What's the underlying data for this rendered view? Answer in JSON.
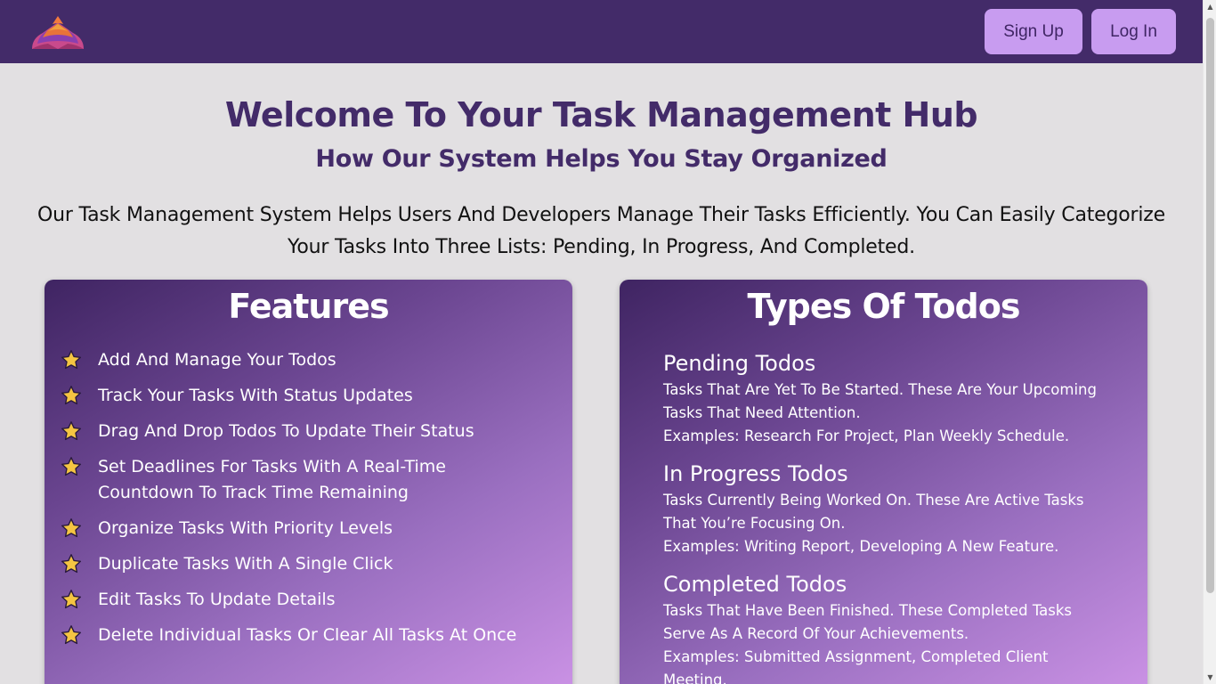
{
  "header": {
    "logo_icon": "layered-pyramid-logo-icon",
    "signup_label": "Sign Up",
    "login_label": "Log In"
  },
  "hero": {
    "title": "Welcome To Your Task Management Hub",
    "subtitle": "How Our System Helps You Stay Organized",
    "description": "Our Task Management System Helps Users And Developers Manage Their Tasks Efficiently. You Can Easily Categorize Your Tasks Into Three Lists: Pending, In Progress, And Completed."
  },
  "features": {
    "title": "Features",
    "icon": "star-icon",
    "items": [
      "Add And Manage Your Todos",
      "Track Your Tasks With Status Updates",
      "Drag And Drop Todos To Update Their Status",
      "Set Deadlines For Tasks With A Real-Time Countdown To Track Time Remaining",
      "Organize Tasks With Priority Levels",
      "Duplicate Tasks With A Single Click",
      "Edit Tasks To Update Details",
      "Delete Individual Tasks Or Clear All Tasks At Once"
    ]
  },
  "types": {
    "title": "Types Of Todos",
    "items": [
      {
        "title": "Pending Todos",
        "description": "Tasks That Are Yet To Be Started. These Are Your Upcoming Tasks That Need Attention.",
        "examples": "Examples: Research For Project, Plan Weekly Schedule."
      },
      {
        "title": "In Progress Todos",
        "description": "Tasks Currently Being Worked On. These Are Active Tasks That You’re Focusing On.",
        "examples": "Examples: Writing Report, Developing A New Feature."
      },
      {
        "title": "Completed Todos",
        "description": "Tasks That Have Been Finished. These Completed Tasks Serve As A Record Of Your Achievements.",
        "examples": "Examples: Submitted Assignment, Completed Client Meeting."
      }
    ]
  },
  "colors": {
    "navbar": "#432b69",
    "button": "#c89cf0",
    "heading": "#432b69",
    "star": "#f5c542"
  }
}
